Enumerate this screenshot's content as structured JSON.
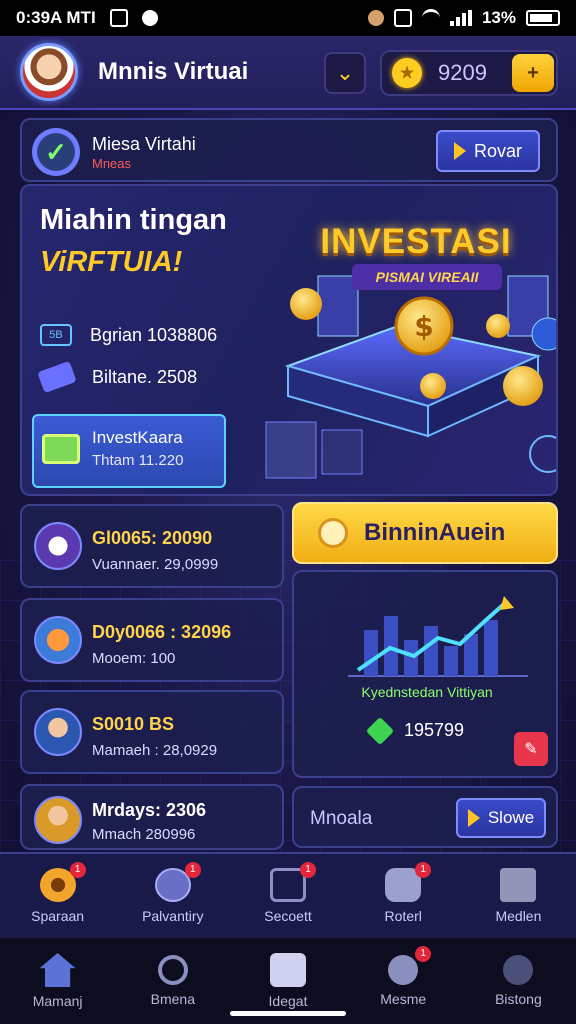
{
  "status_bar": {
    "time": "0:39A MTI",
    "battery": "13%"
  },
  "header": {
    "title": "Mnnis Virtuai",
    "coins": "9209",
    "coin_add_icon": "plus-icon"
  },
  "info_row": {
    "title": "Miesa Virtahi",
    "subtitle": "Mneas",
    "button": "Rovar"
  },
  "hero": {
    "title": "Miahin tingan",
    "subtitle": "ViRFTUIA!",
    "stat1_icon_text": "5B",
    "stat1": "Bgrian 1038806",
    "stat2": "Biltane. 2508",
    "invest_title": "InvestKaara",
    "invest_sub": "Thtam 11.220",
    "promo_title": "INVESTASI",
    "promo_sub": "PISMAI VIREAII"
  },
  "list": [
    {
      "title": "Gl0065: 20090",
      "sub": "Vuannaer. 29,0999"
    },
    {
      "title": "D0y0066 : 32096",
      "sub": "Mooem: 100"
    },
    {
      "title": "S0010 BS",
      "sub": "Mamaeh : 28,0929"
    },
    {
      "title": "Mrdays: 2306",
      "sub": "Mmach  280996"
    }
  ],
  "gold_button": "BinninAuein",
  "chart_panel": {
    "label": "Kyednstedan Vittiyan",
    "value": "195799"
  },
  "small_panel": {
    "label": "Mnoala",
    "button": "Slowe"
  },
  "nav_top": [
    {
      "label": "Sparaan",
      "badge": "1"
    },
    {
      "label": "Palvantiry",
      "badge": "1"
    },
    {
      "label": "Secoett",
      "badge": "1"
    },
    {
      "label": "Roterl",
      "badge": "1"
    },
    {
      "label": "Medlen",
      "badge": ""
    }
  ],
  "nav_bottom": [
    {
      "label": "Mamanj"
    },
    {
      "label": "Bmena"
    },
    {
      "label": "Idegat"
    },
    {
      "label": "Mesme",
      "badge": "1"
    },
    {
      "label": "Bistong"
    }
  ],
  "colors": {
    "accent": "#ffc928",
    "panel": "#1c1f4e",
    "border": "#3b3f8f",
    "positive": "#8dff6a",
    "badge": "#e3263a"
  }
}
